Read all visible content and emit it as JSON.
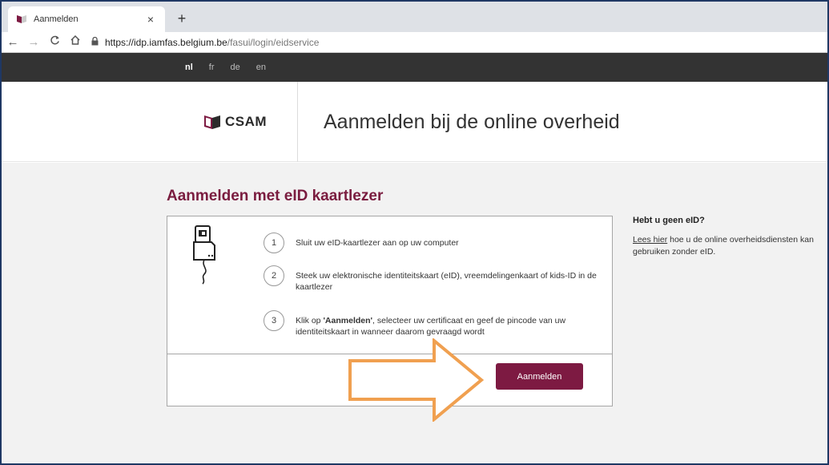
{
  "browser": {
    "tab_title": "Aanmelden",
    "tab_close": "×",
    "new_tab": "+",
    "url_host": "https://idp.iamfas.belgium.be",
    "url_path": "/fasui/login/eidservice",
    "icons": [
      "back-arrow-icon",
      "forward-arrow-icon",
      "reload-icon",
      "home-icon",
      "lock-icon"
    ]
  },
  "languages": [
    {
      "code": "nl",
      "active": true
    },
    {
      "code": "fr",
      "active": false
    },
    {
      "code": "de",
      "active": false
    },
    {
      "code": "en",
      "active": false
    }
  ],
  "header": {
    "logo_text": "CSAM",
    "title": "Aanmelden bij de online overheid"
  },
  "main": {
    "section_title": "Aanmelden met eID kaartlezer",
    "steps": [
      {
        "number": "1",
        "text": "Sluit uw eID-kaartlezer aan op uw computer"
      },
      {
        "number": "2",
        "text": "Steek uw elektronische identiteitskaart (eID), vreemdelingenkaart of kids-ID in de kaartlezer"
      },
      {
        "number": "3",
        "text_bold": "'Aanmelden'",
        "text_before": "Klik op ",
        "text_after": ", selecteer uw certificaat en geef de pincode van uw identiteitskaart in wanneer daarom gevraagd wordt"
      }
    ],
    "login_button": "Aanmelden"
  },
  "side": {
    "title": "Hebt u geen eID?",
    "link_text": "Lees hier",
    "text_line1": " hoe u de online overheidsdiensten kan",
    "text_line2": "gebruiken zonder eID."
  },
  "colors": {
    "brand": "#7d1a42",
    "section_title": "#7a1c3f",
    "langbar": "#333333",
    "arrow": "#f0a050"
  }
}
